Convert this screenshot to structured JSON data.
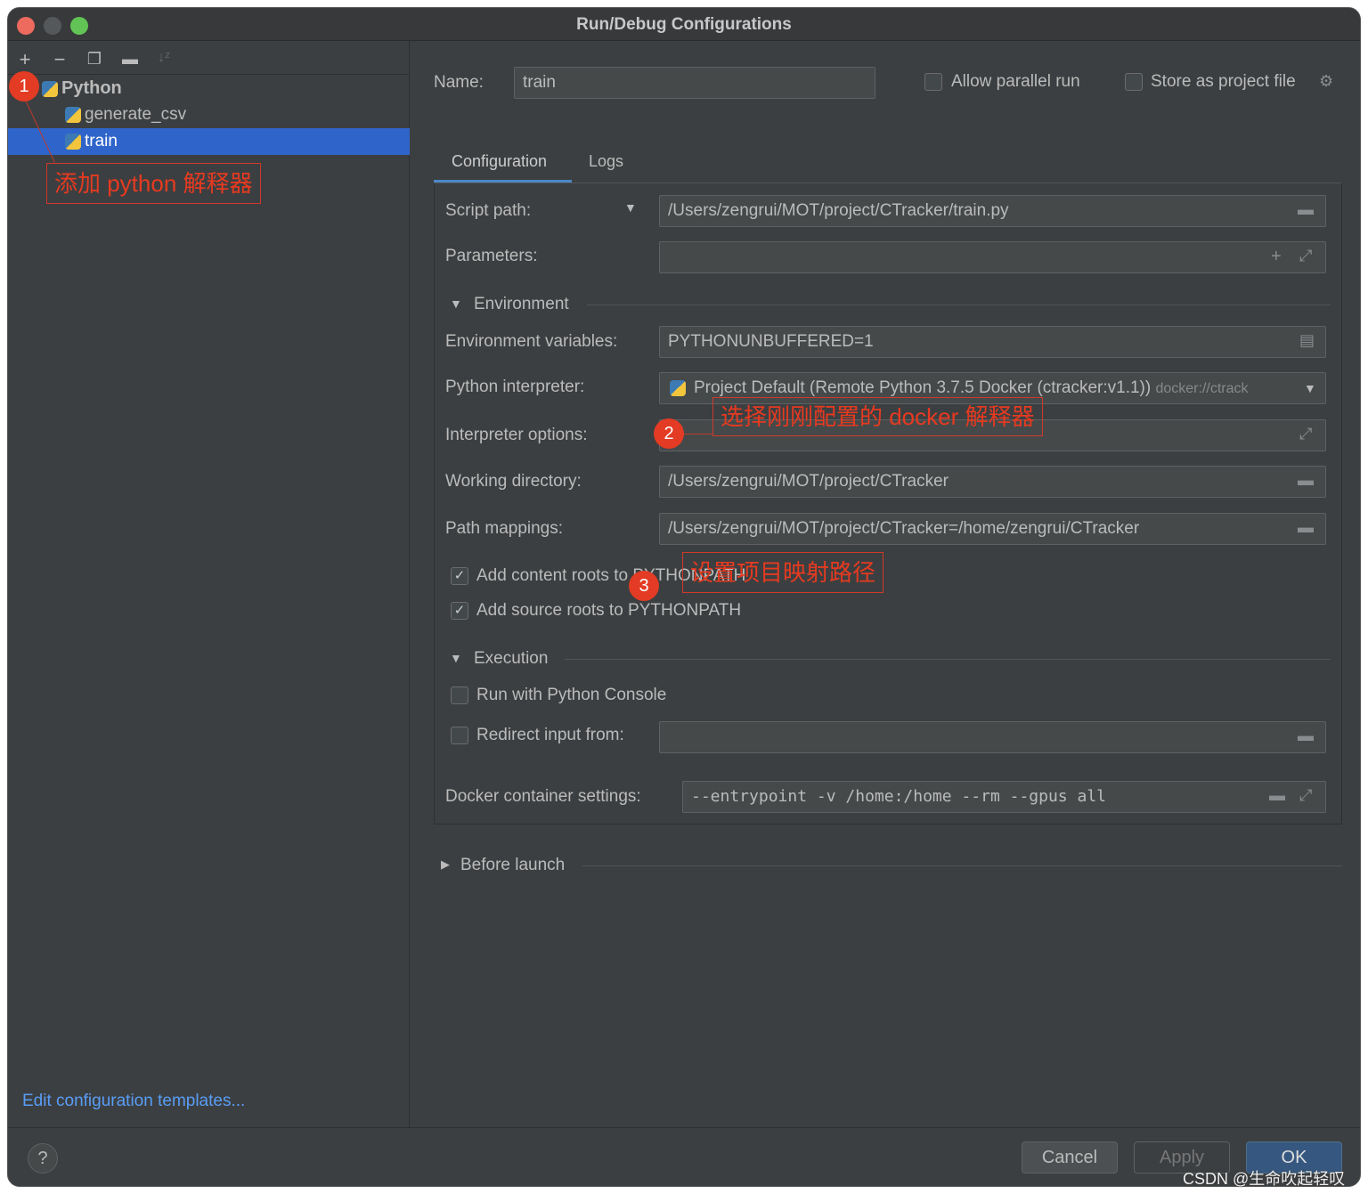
{
  "window": {
    "title": "Run/Debug Configurations"
  },
  "toolbar": {
    "add": "+",
    "remove": "−",
    "copy_icon": "copy-icon",
    "folder_icon": "new-folder-icon",
    "sort_icon": "sort-icon"
  },
  "tree": {
    "group": "Python",
    "items": [
      {
        "label": "generate_csv"
      },
      {
        "label": "train",
        "selected": true
      }
    ]
  },
  "edit_templates": "Edit configuration templates...",
  "name": {
    "label": "Name:",
    "value": "train"
  },
  "allow_parallel": {
    "label": "Allow parallel run",
    "checked": false
  },
  "store_project": {
    "label": "Store as project file",
    "checked": false
  },
  "tabs": [
    {
      "label": "Configuration",
      "active": true
    },
    {
      "label": "Logs"
    }
  ],
  "fields": {
    "script_path": {
      "label": "Script path:",
      "value": "/Users/zengrui/MOT/project/CTracker/train.py"
    },
    "parameters": {
      "label": "Parameters:",
      "value": ""
    },
    "environment": "Environment",
    "env_vars": {
      "label": "Environment variables:",
      "value": "PYTHONUNBUFFERED=1"
    },
    "interpreter": {
      "label": "Python interpreter:",
      "value": "Project Default (Remote Python 3.7.5 Docker (ctracker:v1.1))",
      "hint": "docker://ctrack"
    },
    "interp_options": {
      "label": "Interpreter options:",
      "value": ""
    },
    "working_dir": {
      "label": "Working directory:",
      "value": "/Users/zengrui/MOT/project/CTracker"
    },
    "path_mappings": {
      "label": "Path mappings:",
      "value": "/Users/zengrui/MOT/project/CTracker=/home/zengrui/CTracker"
    },
    "content_roots": {
      "label": "Add content roots to PYTHONPATH",
      "checked": true
    },
    "source_roots": {
      "label": "Add source roots to PYTHONPATH",
      "checked": true
    },
    "execution": "Execution",
    "python_console": {
      "label": "Run with Python Console",
      "checked": false
    },
    "redirect": {
      "label": "Redirect input from:",
      "checked": false,
      "value": ""
    },
    "docker": {
      "label": "Docker container settings:",
      "value": "--entrypoint -v /home:/home --rm --gpus all"
    },
    "before_launch": "Before launch"
  },
  "buttons": {
    "help": "?",
    "cancel": "Cancel",
    "apply": "Apply",
    "ok": "OK"
  },
  "annotations": [
    {
      "num": "1",
      "text": "添加 python 解释器"
    },
    {
      "num": "2",
      "text": "选择刚刚配置的 docker 解释器"
    },
    {
      "num": "3",
      "text": "设置项目映射路径"
    }
  ],
  "watermark": "CSDN @生命吹起轻叹",
  "colors": {
    "selection": "#2f65ca",
    "link": "#589df6",
    "annotation": "#e63a20",
    "ok": "#365880"
  }
}
